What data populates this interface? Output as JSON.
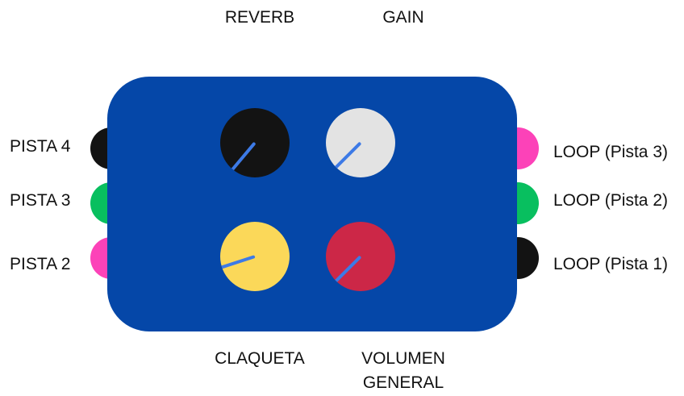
{
  "colors": {
    "panel": "#0547a8",
    "indicator": "#3d7ae6",
    "black": "#131313",
    "green": "#08bf5f",
    "pink": "#fc42b8",
    "light_gray": "#e3e3e3",
    "yellow": "#fbd859",
    "crimson": "#cc2747"
  },
  "top_labels": {
    "reverb": "REVERB",
    "gain": "GAIN"
  },
  "bottom_labels": {
    "claqueta": "CLAQUETA",
    "volumen_line1": "VOLUMEN",
    "volumen_line2": "GENERAL"
  },
  "inputs": [
    {
      "label": "PISTA 4",
      "jack_color": "black"
    },
    {
      "label": "PISTA 3",
      "jack_color": "green"
    },
    {
      "label": "PISTA 2",
      "jack_color": "pink"
    }
  ],
  "outputs": [
    {
      "label": "LOOP (Pista 3)",
      "jack_color": "pink"
    },
    {
      "label": "LOOP (Pista 2)",
      "jack_color": "green"
    },
    {
      "label": "LOOP (Pista 1)",
      "jack_color": "black"
    }
  ],
  "knobs": [
    {
      "name": "REVERB",
      "color": "black",
      "pointer_angle_deg": -50
    },
    {
      "name": "GAIN",
      "color": "light_gray",
      "pointer_angle_deg": -45
    },
    {
      "name": "CLAQUETA",
      "color": "yellow",
      "pointer_angle_deg": -18
    },
    {
      "name": "VOLUMEN GENERAL",
      "color": "crimson",
      "pointer_angle_deg": -45
    }
  ]
}
